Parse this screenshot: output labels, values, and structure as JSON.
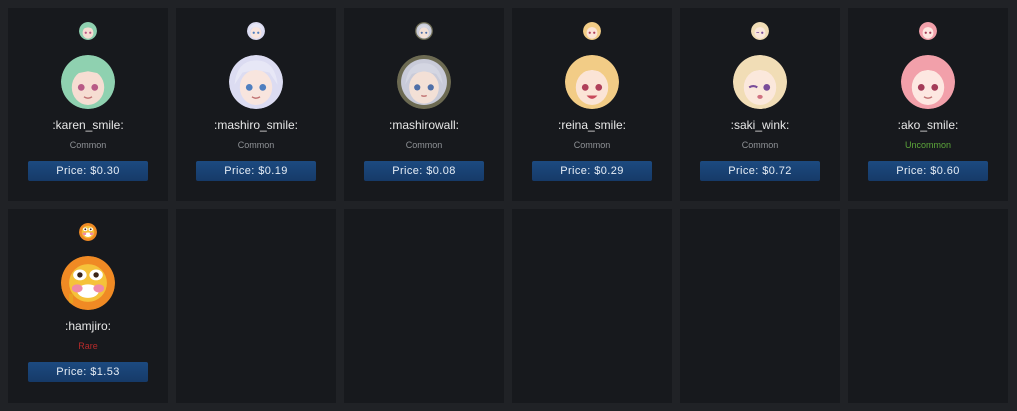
{
  "items": [
    {
      "name": ":karen_smile:",
      "rarity": "Common",
      "price": "Price: $0.30",
      "hair": "#8fd1b0",
      "skin": "#f6ddd2",
      "eyes": "#b85a86"
    },
    {
      "name": ":mashiro_smile:",
      "rarity": "Common",
      "price": "Price: $0.19",
      "hair": "#dcdcf2",
      "skin": "#f8e5de",
      "eyes": "#4f7fc0"
    },
    {
      "name": ":mashirowall:",
      "rarity": "Common",
      "price": "Price: $0.08",
      "hair": "#c9cbd9",
      "skin": "#f3e0d6",
      "eyes": "#4f6fa8"
    },
    {
      "name": ":reina_smile:",
      "rarity": "Common",
      "price": "Price: $0.29",
      "hair": "#f2cc86",
      "skin": "#fbe4d6",
      "eyes": "#b0405a"
    },
    {
      "name": ":saki_wink:",
      "rarity": "Common",
      "price": "Price: $0.72",
      "hair": "#f1ddb6",
      "skin": "#fbe8dc",
      "eyes": "#7a4d9a"
    },
    {
      "name": ":ako_smile:",
      "rarity": "Uncommon",
      "price": "Price: $0.60",
      "hair": "#f2a0aa",
      "skin": "#fde7e1",
      "eyes": "#a43b58"
    },
    {
      "name": ":hamjiro:",
      "rarity": "Rare",
      "price": "Price: $1.53",
      "hair": "#f08a24",
      "skin": "#f5c23a",
      "eyes": "#3a2418"
    }
  ],
  "empty_slots": 5
}
